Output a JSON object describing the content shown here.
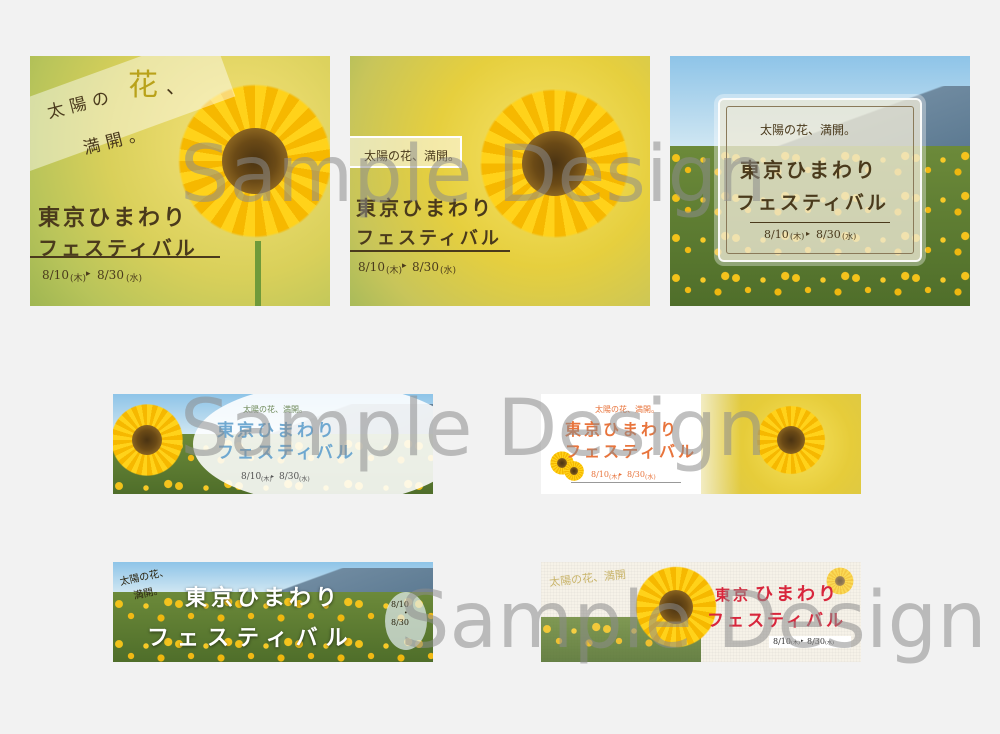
{
  "banners": {
    "b1": {
      "tagline_1": "太陽の",
      "tagline_flower": "花",
      "tagline_2": "、",
      "tagline_3": "満開。",
      "title_1": "東京ひまわり",
      "title_2": "フェスティバル",
      "date_start": "8/10",
      "date_start_day": "(木)",
      "date_end": "8/30",
      "date_end_day": "(水)"
    },
    "b2": {
      "tagline": "太陽の花、満開。",
      "title_1": "東京ひまわり",
      "title_2": "フェスティバル",
      "date_start": "8/10",
      "date_start_day": "(木)",
      "date_end": "8/30",
      "date_end_day": "(水)"
    },
    "b3": {
      "tagline": "太陽の花、満開。",
      "title_1": "東京ひまわり",
      "title_2": "フェスティバル",
      "date_start": "8/10",
      "date_start_day": "(木)",
      "date_end": "8/30",
      "date_end_day": "(水)"
    },
    "b4": {
      "tagline": "太陽の花、満開。",
      "title_1": "東京ひまわり",
      "title_2": "フェスティバル",
      "date_start": "8/10",
      "date_start_day": "(木)",
      "date_end": "8/30",
      "date_end_day": "(水)"
    },
    "b5": {
      "tagline": "太陽の花、満開。",
      "title_1": "東京ひまわり",
      "title_2": "フェスティバル",
      "date_start": "8/10",
      "date_start_day": "(木)",
      "date_end": "8/30",
      "date_end_day": "(水)"
    },
    "b6": {
      "tagline_1": "太陽の花、",
      "tagline_2": "満開。",
      "title_1": "東京ひまわり",
      "title_2": "フェスティバル",
      "date_start": "8/10",
      "date_end": "8/30"
    },
    "b7": {
      "tagline": "太陽の花、満開",
      "title_1": "東京",
      "title_2": "ひまわり",
      "title_3": "フェスティバル",
      "date_start": "8/10",
      "date_start_day": "(木)",
      "date_end": "8/30",
      "date_end_day": "(水)"
    }
  },
  "watermark": "Sample Design",
  "colors": {
    "background": "#f2f2f2",
    "title_brown": "#4a3a1c",
    "title_blue": "#6fa8d0",
    "title_orange": "#e8743c",
    "title_red": "#d8263c",
    "sunflower": "#ffd21a"
  }
}
